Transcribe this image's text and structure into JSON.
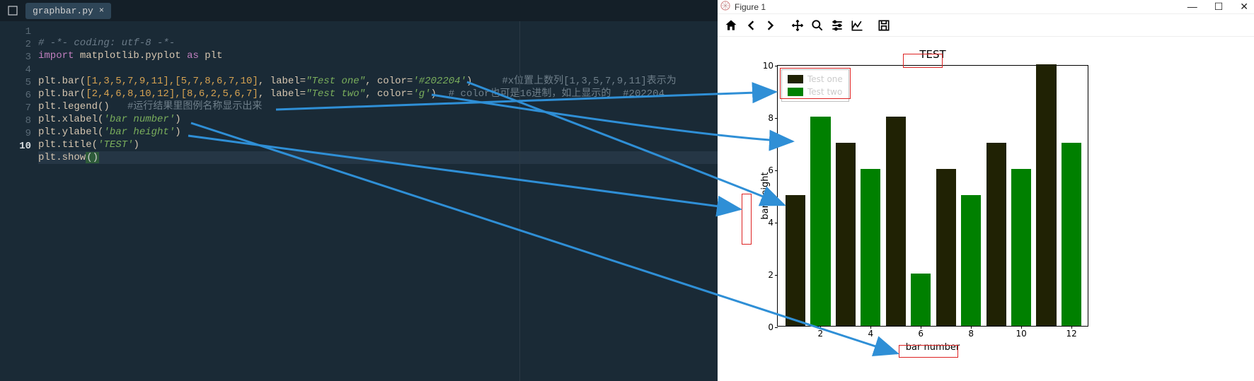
{
  "editor": {
    "tab": {
      "filename": "graphbar.py"
    },
    "lines": [
      "1",
      "2",
      "3",
      "4",
      "5",
      "6",
      "7",
      "8",
      "9",
      "10"
    ],
    "code": {
      "l1": "# -*- coding: utf-8 -*-",
      "l2_import": "import",
      "l2_mod": " matplotlib.pyplot ",
      "l2_as": "as",
      "l2_alias": " plt",
      "l4_pre": "plt.bar(",
      "l4_args": "[1,3,5,7,9,11],[5,7,8,6,7,10]",
      "l4_mid": ", label=",
      "l4_str1": "\"Test one\"",
      "l4_mid2": ", color=",
      "l4_str2": "'#202204'",
      "l4_end": ")",
      "l4_cmt": "     #x位置上数列[1,3,5,7,9,11]表示为",
      "l5_pre": "plt.bar(",
      "l5_args": "[2,4,6,8,10,12],[8,6,2,5,6,7]",
      "l5_mid": ", label=",
      "l5_str1": "\"Test two\"",
      "l5_mid2": ", color=",
      "l5_str2": "'g'",
      "l5_end": ")",
      "l5_cmt": "  # color也可是16进制，如上显示的  #202204",
      "l6_pre": "plt.legend()",
      "l6_cmt": "   #运行结果里图例名称显示出来",
      "l7_pre": "plt.xlabel(",
      "l7_str": "'bar number'",
      "l7_end": ")",
      "l8_pre": "plt.ylabel(",
      "l8_str": "'bar height'",
      "l8_end": ")",
      "l9_pre": "plt.title(",
      "l9_str": "'TEST'",
      "l9_end": ")",
      "l10_pre": "plt.show",
      "l10_paren": "()"
    }
  },
  "mpl_window_title": "Figure 1",
  "winctl": {
    "min": "—",
    "max": "☐",
    "close": "✕"
  },
  "chart_data": {
    "type": "bar",
    "title": "TEST",
    "xlabel": "bar number",
    "ylabel": "bar height",
    "ylim": [
      0,
      10
    ],
    "yticks": [
      0,
      2,
      4,
      6,
      8,
      10
    ],
    "xticks": [
      2,
      4,
      6,
      8,
      10,
      12
    ],
    "series": [
      {
        "name": "Test one",
        "color": "#202204",
        "x": [
          1,
          3,
          5,
          7,
          9,
          11
        ],
        "values": [
          5,
          7,
          8,
          6,
          7,
          10
        ]
      },
      {
        "name": "Test two",
        "color": "#008000",
        "x": [
          2,
          4,
          6,
          8,
          10,
          12
        ],
        "values": [
          8,
          6,
          2,
          5,
          6,
          7
        ]
      }
    ]
  }
}
